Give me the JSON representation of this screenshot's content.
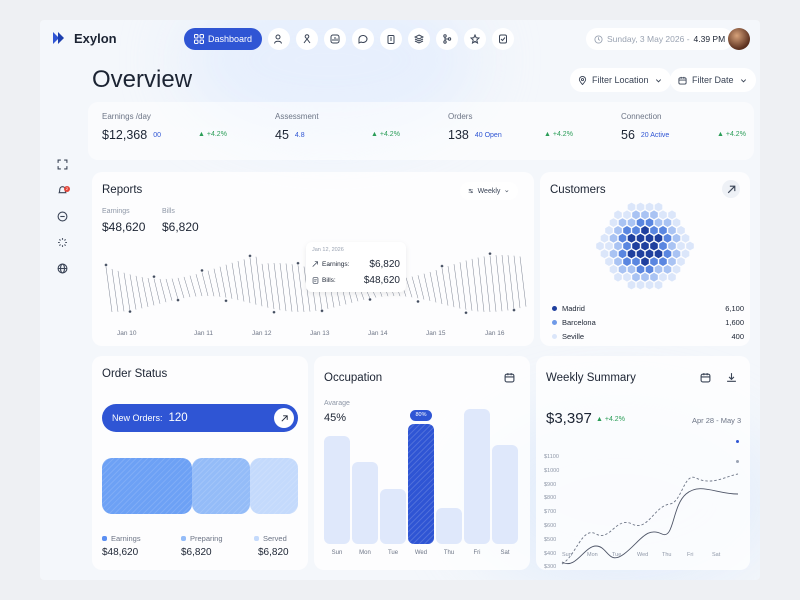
{
  "app": {
    "name": "Exylon"
  },
  "nav": {
    "active_label": "Dashboard",
    "icons": [
      "users-icon",
      "user-tree-icon",
      "analytics-icon",
      "chat-icon",
      "clipboard-icon",
      "layers-icon",
      "git-branch-icon",
      "star-icon",
      "checklist-icon"
    ]
  },
  "header": {
    "date": "Sunday, 3 May 2026 -",
    "time": "4.39 PM"
  },
  "page": {
    "title": "Overview"
  },
  "filters": {
    "location": "Filter Location",
    "date": "Filter Date"
  },
  "stats": [
    {
      "label": "Earnings /day",
      "value": "$12,368",
      "sub": "00",
      "change": "+4.2%"
    },
    {
      "label": "Assessment",
      "value": "45",
      "sub": "4.8",
      "change": "+4.2%"
    },
    {
      "label": "Orders",
      "value": "138",
      "sub": "40 Open",
      "change": "+4.2%"
    },
    {
      "label": "Connection",
      "value": "56",
      "sub": "20 Active",
      "change": "+4.2%"
    }
  ],
  "reports": {
    "title": "Reports",
    "period": "Weekly",
    "earnings_label": "Earnings",
    "earnings_value": "$48,620",
    "bills_label": "Bills",
    "bills_value": "$6,820",
    "tooltip": {
      "date": "Jan 12, 2026",
      "earnings_label": "Earnings:",
      "earnings_value": "$6,820",
      "bills_label": "Bills:",
      "bills_value": "$48,620"
    },
    "x_labels": [
      "Jan 10",
      "Jan 11",
      "Jan 12",
      "Jan 13",
      "Jan 14",
      "Jan 15",
      "Jan 16"
    ]
  },
  "customers": {
    "title": "Customers",
    "items": [
      {
        "city": "Madrid",
        "value": "6,100",
        "color": "#1f3f9e"
      },
      {
        "city": "Barcelona",
        "value": "1,600",
        "color": "#6f9ae8"
      },
      {
        "city": "Seville",
        "value": "400",
        "color": "#dbe6fa"
      }
    ]
  },
  "order_status": {
    "title": "Order Status",
    "new_orders_label": "New Orders:",
    "new_orders_value": "120",
    "segments": [
      {
        "label": "Earnings",
        "value": "$48,620",
        "color": "#6da1f5"
      },
      {
        "label": "Preparing",
        "value": "$6,820",
        "color": "#94bcf8"
      },
      {
        "label": "Served",
        "value": "$6,820",
        "color": "#c4dafc"
      }
    ]
  },
  "occupation": {
    "title": "Occupation",
    "avg_label": "Avarage",
    "avg_value": "45%",
    "highlight": "80%",
    "days": [
      "Sun",
      "Mon",
      "Tue",
      "Wed",
      "Thu",
      "Fri",
      "Sat"
    ],
    "values": [
      0.72,
      0.55,
      0.37,
      0.8,
      0.24,
      0.9,
      0.66
    ]
  },
  "weekly": {
    "title": "Weekly Summary",
    "value": "$3,397",
    "change": "+4.2%",
    "range": "Apr 28 - May 3",
    "y_labels": [
      "$1100",
      "$1000",
      "$900",
      "$800",
      "$700",
      "$600",
      "$500",
      "$400",
      "$300"
    ],
    "days": [
      "Sun",
      "Mon",
      "Tue",
      "Wed",
      "Thu",
      "Fri",
      "Sat"
    ]
  },
  "colors": {
    "primary": "#2f55d4",
    "positive": "#2a9d57"
  }
}
